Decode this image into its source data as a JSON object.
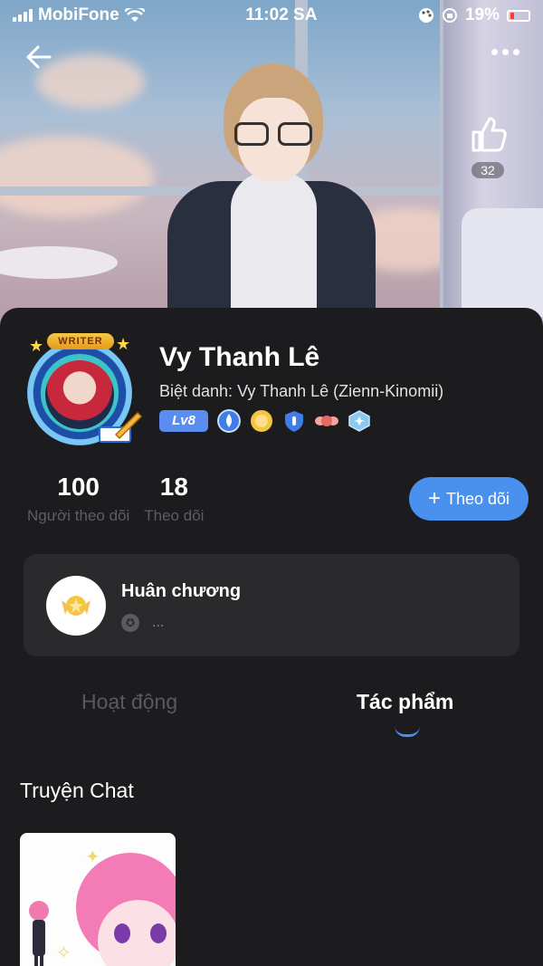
{
  "status_bar": {
    "carrier": "MobiFone",
    "time": "11:02 SA",
    "battery": "19%"
  },
  "header": {
    "like_count": "32"
  },
  "profile": {
    "name": "Vy Thanh Lê",
    "nickname_label": "Biệt danh:",
    "nickname_value": "Vy Thanh Lê (Zienn-Kinomii)",
    "level": "Lv8",
    "avatar_badge": "WRITER"
  },
  "stats": {
    "followers_count": "100",
    "followers_label": "Người theo dõi",
    "following_count": "18",
    "following_label": "Theo dõi"
  },
  "follow_button": {
    "label": "Theo dõi"
  },
  "medals": {
    "title": "Huân chương",
    "subtitle": "..."
  },
  "tabs": [
    {
      "label": "Hoạt động",
      "active": false
    },
    {
      "label": "Tác phẩm",
      "active": true
    }
  ],
  "section": {
    "title": "Truyện Chat"
  },
  "colors": {
    "background": "#1c1c1e",
    "accent": "#4a90ef",
    "card": "#2a2a2c",
    "muted_text": "#5e5e62"
  },
  "icons": {
    "back": "arrow-left-icon",
    "more": "more-dots-icon",
    "like": "thumbs-up-icon",
    "wifi": "wifi-icon",
    "signal": "signal-icon",
    "battery": "battery-icon"
  }
}
